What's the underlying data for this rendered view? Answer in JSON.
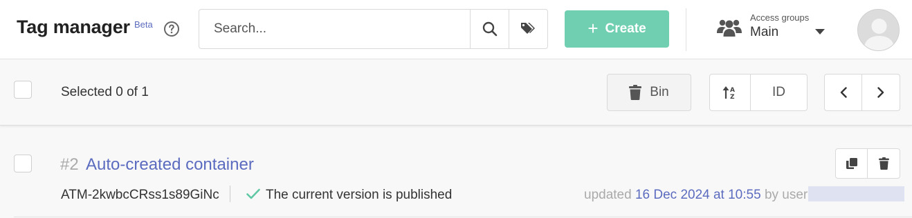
{
  "header": {
    "title": "Tag manager",
    "beta": "Beta",
    "search_placeholder": "Search...",
    "create_label": "Create",
    "access_groups_label": "Access groups",
    "access_groups_value": "Main"
  },
  "toolbar": {
    "selected_text": "Selected 0 of 1",
    "bin_label": "Bin",
    "sort_field": "ID"
  },
  "rows": [
    {
      "number": "#2",
      "title": "Auto-created container",
      "public_id": "ATM-2kwbcCRss1s89GiNc",
      "status": "The current version is published",
      "updated_prefix": "updated",
      "updated_date": "16 Dec 2024 at 10:55",
      "updated_by": "by user"
    }
  ],
  "colors": {
    "accent": "#5b6bbf",
    "create": "#6fcfb0",
    "check": "#5fc7a5"
  },
  "icons": [
    "help-icon",
    "search-icon",
    "tags-icon",
    "plus-icon",
    "users-icon",
    "caret-down-icon",
    "avatar",
    "trash-icon",
    "sort-alpha-icon",
    "chevron-left-icon",
    "chevron-right-icon",
    "copy-icon",
    "check-icon"
  ]
}
